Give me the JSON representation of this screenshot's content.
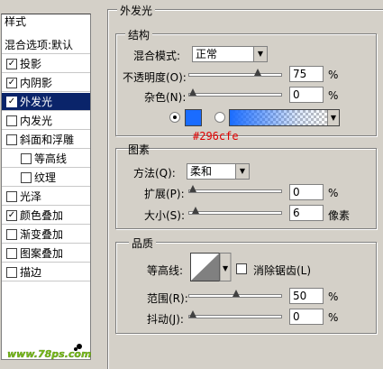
{
  "styles": {
    "header": "样式",
    "items": [
      {
        "label": "混合选项:默认",
        "checkbox": false,
        "checked": false,
        "selected": false,
        "indent": false
      },
      {
        "label": "投影",
        "checkbox": true,
        "checked": true,
        "selected": false,
        "indent": false
      },
      {
        "label": "内阴影",
        "checkbox": true,
        "checked": true,
        "selected": false,
        "indent": false
      },
      {
        "label": "外发光",
        "checkbox": true,
        "checked": true,
        "selected": true,
        "indent": false
      },
      {
        "label": "内发光",
        "checkbox": true,
        "checked": false,
        "selected": false,
        "indent": false
      },
      {
        "label": "斜面和浮雕",
        "checkbox": true,
        "checked": false,
        "selected": false,
        "indent": false
      },
      {
        "label": "等高线",
        "checkbox": true,
        "checked": false,
        "selected": false,
        "indent": true
      },
      {
        "label": "纹理",
        "checkbox": true,
        "checked": false,
        "selected": false,
        "indent": true
      },
      {
        "label": "光泽",
        "checkbox": true,
        "checked": false,
        "selected": false,
        "indent": false
      },
      {
        "label": "颜色叠加",
        "checkbox": true,
        "checked": true,
        "selected": false,
        "indent": false
      },
      {
        "label": "渐变叠加",
        "checkbox": true,
        "checked": false,
        "selected": false,
        "indent": false
      },
      {
        "label": "图案叠加",
        "checkbox": true,
        "checked": false,
        "selected": false,
        "indent": false
      },
      {
        "label": "描边",
        "checkbox": true,
        "checked": false,
        "selected": false,
        "indent": false
      }
    ]
  },
  "watermark": "www.78ps.com",
  "outer_glow": {
    "title": "外发光",
    "structure": {
      "title": "结构",
      "blend_mode_label": "混合模式:",
      "blend_mode_value": "正常",
      "opacity_label": "不透明度(O):",
      "opacity_value": "75",
      "opacity_unit": "%",
      "opacity_level": 0.75,
      "noise_label": "杂色(N):",
      "noise_value": "0",
      "noise_unit": "%",
      "noise_level": 0,
      "color_annotation": "#296cfe",
      "color_swatch": "#1a6cff"
    },
    "elements": {
      "title": "图素",
      "method_label": "方法(Q):",
      "method_value": "柔和",
      "spread_label": "扩展(P):",
      "spread_value": "0",
      "spread_unit": "%",
      "spread_level": 0,
      "size_label": "大小(S):",
      "size_value": "6",
      "size_unit": "像素",
      "size_level": 0.03
    },
    "quality": {
      "title": "品质",
      "contour_label": "等高线:",
      "antialias_label": "消除锯齿(L)",
      "range_label": "范围(R):",
      "range_value": "50",
      "range_unit": "%",
      "range_level": 0.5,
      "jitter_label": "抖动(J):",
      "jitter_value": "0",
      "jitter_unit": "%",
      "jitter_level": 0
    }
  }
}
